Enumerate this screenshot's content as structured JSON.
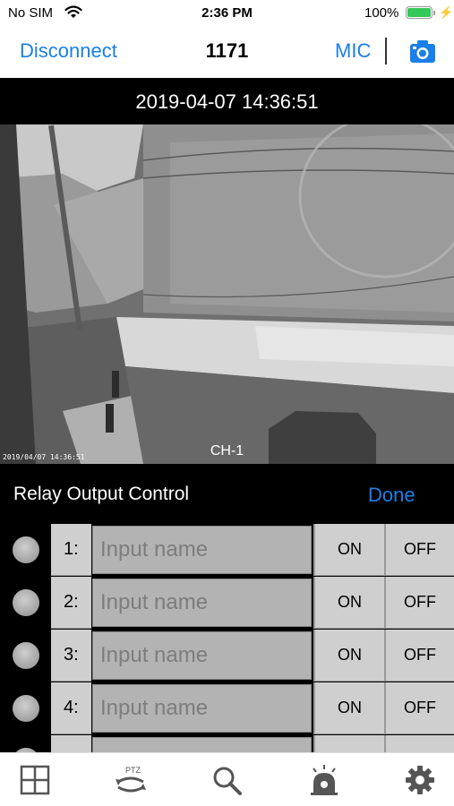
{
  "status_bar": {
    "carrier": "No SIM",
    "time": "2:36 PM",
    "battery_percent": "100%",
    "battery_level": 1.0,
    "icons": [
      "wifi-icon",
      "battery-icon",
      "charging-bolt-icon"
    ]
  },
  "nav": {
    "disconnect_label": "Disconnect",
    "title": "1171",
    "mic_label": "MIC",
    "camera_icon": "camera-icon"
  },
  "video": {
    "timestamp": "2019-04-07 14:36:51",
    "channel_label": "CH-1",
    "osd_timestamp": "2019/04/07 14:36:51"
  },
  "relay": {
    "title": "Relay Output Control",
    "done_label": "Done",
    "rows": [
      {
        "number": "1:",
        "placeholder": "Input name",
        "on_label": "ON",
        "off_label": "OFF"
      },
      {
        "number": "2:",
        "placeholder": "Input name",
        "on_label": "ON",
        "off_label": "OFF"
      },
      {
        "number": "3:",
        "placeholder": "Input name",
        "on_label": "ON",
        "off_label": "OFF"
      },
      {
        "number": "4:",
        "placeholder": "Input name",
        "on_label": "ON",
        "off_label": "OFF"
      },
      {
        "number": "",
        "placeholder": "",
        "on_label": "",
        "off_label": ""
      }
    ]
  },
  "tab_bar": {
    "items": [
      {
        "icon": "grid-icon"
      },
      {
        "icon": "ptz-icon",
        "text": "PTZ"
      },
      {
        "icon": "search-icon"
      },
      {
        "icon": "alarm-icon"
      },
      {
        "icon": "settings-icon"
      }
    ]
  },
  "colors": {
    "accent": "#1a7fe6",
    "battery": "#34c759",
    "relay_cell": "#cfcfcf",
    "input_bg": "#b3b3b3"
  }
}
